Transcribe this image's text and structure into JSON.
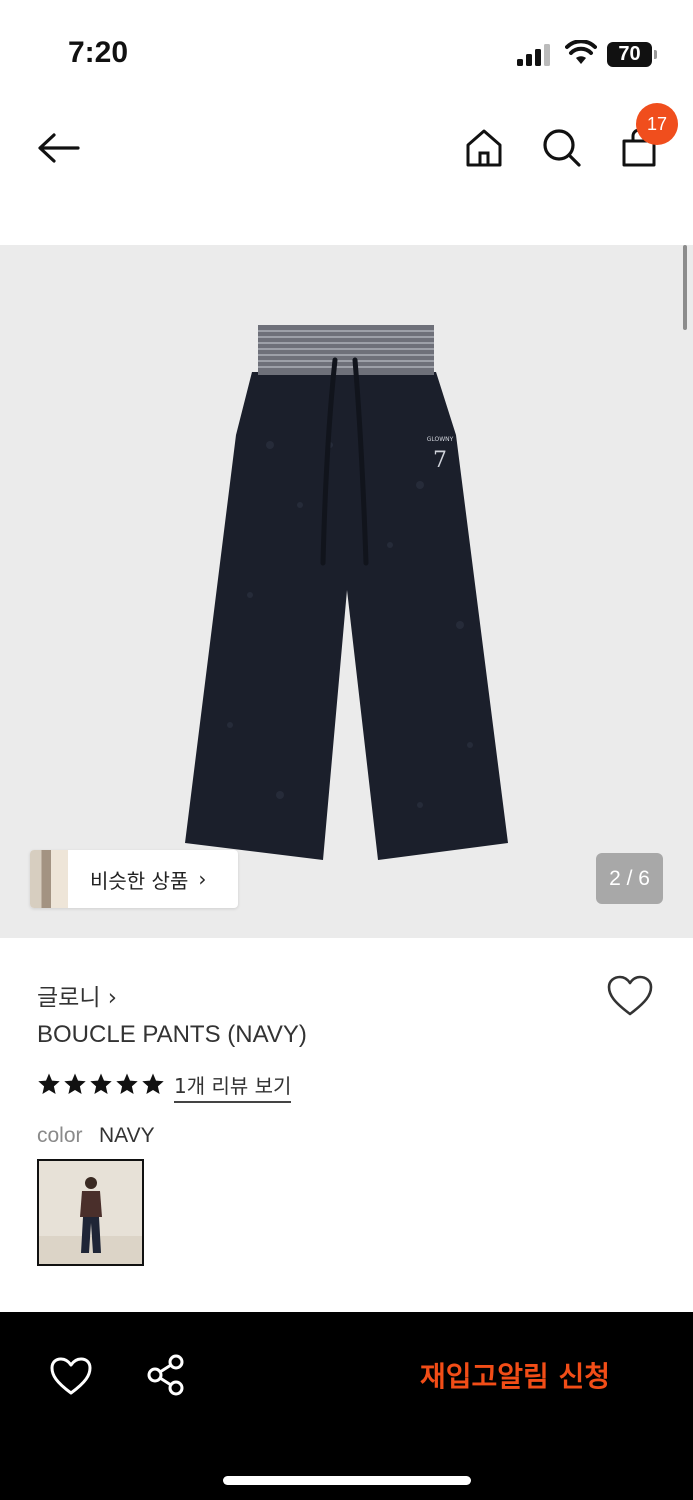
{
  "status": {
    "time": "7:20",
    "battery": "70"
  },
  "header": {
    "cart_count": "17"
  },
  "gallery": {
    "similar_label": "비슷한 상품",
    "chevron": "›",
    "counter": "2 / 6"
  },
  "product": {
    "brand": "글로니 ›",
    "name": "BOUCLE PANTS (NAVY)",
    "rating_stars": 5,
    "review_link": "1개 리뷰 보기",
    "color_label": "color",
    "color_value": "NAVY"
  },
  "bottom": {
    "restock_label": "재입고알림 신청"
  },
  "colors": {
    "accent": "#f04e1d",
    "navy": "#1b1f2b",
    "bar": "#000000"
  }
}
